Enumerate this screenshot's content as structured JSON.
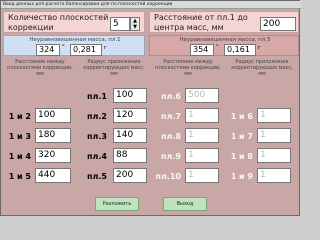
{
  "window": {
    "title": "Ввод данных для расчета балансировки для пл.плоскостей коррекции"
  },
  "top_left": {
    "label": "Количество плоскостей коррекции",
    "value": "5"
  },
  "top_right": {
    "label": "Расстояние от пл.1 до центра масс, мм",
    "value": "200"
  },
  "unbalance_left": {
    "label": "Неуравновешенная масса, пл.1",
    "angle": "324",
    "deg": "°",
    "mass": "0,281",
    "unit": "г"
  },
  "unbalance_right": {
    "label": "Неуравновешенная масса, пл.5",
    "angle": "354",
    "deg": "°",
    "mass": "0,161",
    "unit": "г"
  },
  "headers": {
    "dist": "Расстояние между плоскостями коррекции, мм",
    "rad": "Радиус приложения корректирующих масс, мм",
    "dist_r": "Расстояние между плоскостями коррекции, мм",
    "rad_r": "Радиус приложения корректирующих масс, мм"
  },
  "rows_left": [
    {
      "pair": "",
      "dist": "",
      "plane": "пл.1",
      "radius": "100"
    },
    {
      "pair": "1 и 2",
      "dist": "100",
      "plane": "пл.2",
      "radius": "120"
    },
    {
      "pair": "1 и 3",
      "dist": "180",
      "plane": "пл.3",
      "radius": "140"
    },
    {
      "pair": "1 и 4",
      "dist": "320",
      "plane": "пл.4",
      "radius": "88"
    },
    {
      "pair": "1 и 5",
      "dist": "440",
      "plane": "пл.5",
      "radius": "200"
    }
  ],
  "rows_right": [
    {
      "plane": "пл.6",
      "radius": "500",
      "dist_pair": "",
      "dist": ""
    },
    {
      "plane": "пл.7",
      "radius": "1",
      "dist_pair": "1 и 6",
      "dist": "1"
    },
    {
      "plane": "пл.8",
      "radius": "1",
      "dist_pair": "1 и 7",
      "dist": "1"
    },
    {
      "plane": "пл.9",
      "radius": "1",
      "dist_pair": "1 и 8",
      "dist": "1"
    },
    {
      "plane": "пл.10",
      "radius": "1",
      "dist_pair": "1 и 9",
      "dist": "1"
    }
  ],
  "buttons": {
    "solve": "Разложить",
    "exit": "Выход"
  }
}
